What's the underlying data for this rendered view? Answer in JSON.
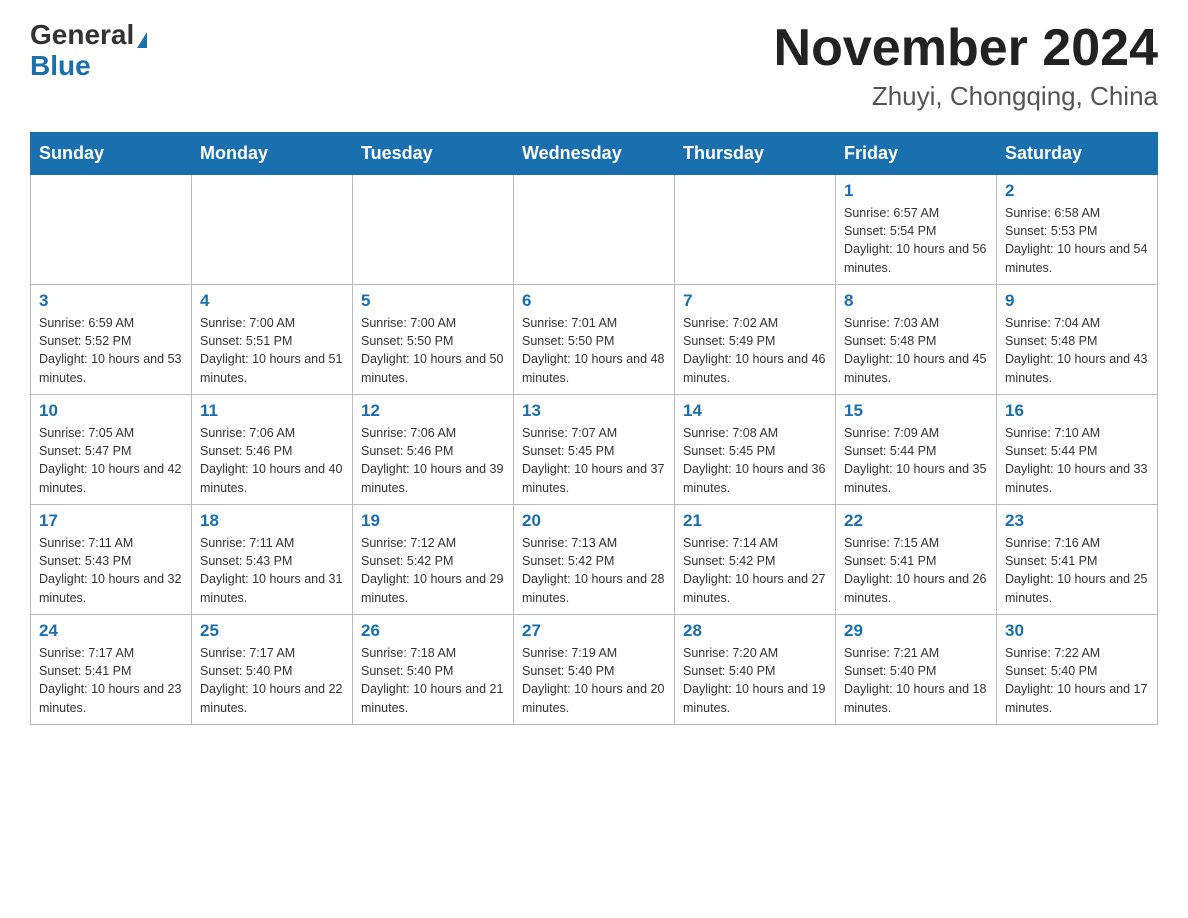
{
  "header": {
    "logo_general": "General",
    "logo_blue": "Blue",
    "month_title": "November 2024",
    "location": "Zhuyi, Chongqing, China"
  },
  "weekdays": [
    "Sunday",
    "Monday",
    "Tuesday",
    "Wednesday",
    "Thursday",
    "Friday",
    "Saturday"
  ],
  "weeks": [
    [
      {
        "day": "",
        "sunrise": "",
        "sunset": "",
        "daylight": ""
      },
      {
        "day": "",
        "sunrise": "",
        "sunset": "",
        "daylight": ""
      },
      {
        "day": "",
        "sunrise": "",
        "sunset": "",
        "daylight": ""
      },
      {
        "day": "",
        "sunrise": "",
        "sunset": "",
        "daylight": ""
      },
      {
        "day": "",
        "sunrise": "",
        "sunset": "",
        "daylight": ""
      },
      {
        "day": "1",
        "sunrise": "Sunrise: 6:57 AM",
        "sunset": "Sunset: 5:54 PM",
        "daylight": "Daylight: 10 hours and 56 minutes."
      },
      {
        "day": "2",
        "sunrise": "Sunrise: 6:58 AM",
        "sunset": "Sunset: 5:53 PM",
        "daylight": "Daylight: 10 hours and 54 minutes."
      }
    ],
    [
      {
        "day": "3",
        "sunrise": "Sunrise: 6:59 AM",
        "sunset": "Sunset: 5:52 PM",
        "daylight": "Daylight: 10 hours and 53 minutes."
      },
      {
        "day": "4",
        "sunrise": "Sunrise: 7:00 AM",
        "sunset": "Sunset: 5:51 PM",
        "daylight": "Daylight: 10 hours and 51 minutes."
      },
      {
        "day": "5",
        "sunrise": "Sunrise: 7:00 AM",
        "sunset": "Sunset: 5:50 PM",
        "daylight": "Daylight: 10 hours and 50 minutes."
      },
      {
        "day": "6",
        "sunrise": "Sunrise: 7:01 AM",
        "sunset": "Sunset: 5:50 PM",
        "daylight": "Daylight: 10 hours and 48 minutes."
      },
      {
        "day": "7",
        "sunrise": "Sunrise: 7:02 AM",
        "sunset": "Sunset: 5:49 PM",
        "daylight": "Daylight: 10 hours and 46 minutes."
      },
      {
        "day": "8",
        "sunrise": "Sunrise: 7:03 AM",
        "sunset": "Sunset: 5:48 PM",
        "daylight": "Daylight: 10 hours and 45 minutes."
      },
      {
        "day": "9",
        "sunrise": "Sunrise: 7:04 AM",
        "sunset": "Sunset: 5:48 PM",
        "daylight": "Daylight: 10 hours and 43 minutes."
      }
    ],
    [
      {
        "day": "10",
        "sunrise": "Sunrise: 7:05 AM",
        "sunset": "Sunset: 5:47 PM",
        "daylight": "Daylight: 10 hours and 42 minutes."
      },
      {
        "day": "11",
        "sunrise": "Sunrise: 7:06 AM",
        "sunset": "Sunset: 5:46 PM",
        "daylight": "Daylight: 10 hours and 40 minutes."
      },
      {
        "day": "12",
        "sunrise": "Sunrise: 7:06 AM",
        "sunset": "Sunset: 5:46 PM",
        "daylight": "Daylight: 10 hours and 39 minutes."
      },
      {
        "day": "13",
        "sunrise": "Sunrise: 7:07 AM",
        "sunset": "Sunset: 5:45 PM",
        "daylight": "Daylight: 10 hours and 37 minutes."
      },
      {
        "day": "14",
        "sunrise": "Sunrise: 7:08 AM",
        "sunset": "Sunset: 5:45 PM",
        "daylight": "Daylight: 10 hours and 36 minutes."
      },
      {
        "day": "15",
        "sunrise": "Sunrise: 7:09 AM",
        "sunset": "Sunset: 5:44 PM",
        "daylight": "Daylight: 10 hours and 35 minutes."
      },
      {
        "day": "16",
        "sunrise": "Sunrise: 7:10 AM",
        "sunset": "Sunset: 5:44 PM",
        "daylight": "Daylight: 10 hours and 33 minutes."
      }
    ],
    [
      {
        "day": "17",
        "sunrise": "Sunrise: 7:11 AM",
        "sunset": "Sunset: 5:43 PM",
        "daylight": "Daylight: 10 hours and 32 minutes."
      },
      {
        "day": "18",
        "sunrise": "Sunrise: 7:11 AM",
        "sunset": "Sunset: 5:43 PM",
        "daylight": "Daylight: 10 hours and 31 minutes."
      },
      {
        "day": "19",
        "sunrise": "Sunrise: 7:12 AM",
        "sunset": "Sunset: 5:42 PM",
        "daylight": "Daylight: 10 hours and 29 minutes."
      },
      {
        "day": "20",
        "sunrise": "Sunrise: 7:13 AM",
        "sunset": "Sunset: 5:42 PM",
        "daylight": "Daylight: 10 hours and 28 minutes."
      },
      {
        "day": "21",
        "sunrise": "Sunrise: 7:14 AM",
        "sunset": "Sunset: 5:42 PM",
        "daylight": "Daylight: 10 hours and 27 minutes."
      },
      {
        "day": "22",
        "sunrise": "Sunrise: 7:15 AM",
        "sunset": "Sunset: 5:41 PM",
        "daylight": "Daylight: 10 hours and 26 minutes."
      },
      {
        "day": "23",
        "sunrise": "Sunrise: 7:16 AM",
        "sunset": "Sunset: 5:41 PM",
        "daylight": "Daylight: 10 hours and 25 minutes."
      }
    ],
    [
      {
        "day": "24",
        "sunrise": "Sunrise: 7:17 AM",
        "sunset": "Sunset: 5:41 PM",
        "daylight": "Daylight: 10 hours and 23 minutes."
      },
      {
        "day": "25",
        "sunrise": "Sunrise: 7:17 AM",
        "sunset": "Sunset: 5:40 PM",
        "daylight": "Daylight: 10 hours and 22 minutes."
      },
      {
        "day": "26",
        "sunrise": "Sunrise: 7:18 AM",
        "sunset": "Sunset: 5:40 PM",
        "daylight": "Daylight: 10 hours and 21 minutes."
      },
      {
        "day": "27",
        "sunrise": "Sunrise: 7:19 AM",
        "sunset": "Sunset: 5:40 PM",
        "daylight": "Daylight: 10 hours and 20 minutes."
      },
      {
        "day": "28",
        "sunrise": "Sunrise: 7:20 AM",
        "sunset": "Sunset: 5:40 PM",
        "daylight": "Daylight: 10 hours and 19 minutes."
      },
      {
        "day": "29",
        "sunrise": "Sunrise: 7:21 AM",
        "sunset": "Sunset: 5:40 PM",
        "daylight": "Daylight: 10 hours and 18 minutes."
      },
      {
        "day": "30",
        "sunrise": "Sunrise: 7:22 AM",
        "sunset": "Sunset: 5:40 PM",
        "daylight": "Daylight: 10 hours and 17 minutes."
      }
    ]
  ]
}
